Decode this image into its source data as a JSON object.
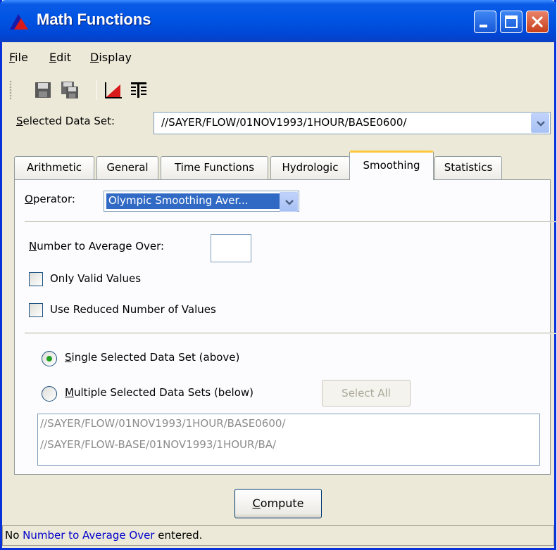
{
  "window": {
    "title": "Math Functions",
    "title_bar_color": "#0054E3"
  },
  "menu": {
    "items": [
      {
        "label": "File",
        "mnemonic": "F",
        "rest": "ile"
      },
      {
        "label": "Edit",
        "mnemonic": "E",
        "rest": "dit"
      },
      {
        "label": "Display",
        "mnemonic": "D",
        "rest": "isplay"
      }
    ]
  },
  "toolbar": {
    "icons": [
      "save-icon",
      "save-as-icon",
      "plot-icon",
      "tabulate-icon"
    ]
  },
  "selected_data_set": {
    "label_mnemonic": "S",
    "label_rest": "elected Data Set:",
    "value": "//SAYER/FLOW/01NOV1993/1HOUR/BASE0600/"
  },
  "tabs": [
    {
      "label": "Arithmetic",
      "active": false
    },
    {
      "label": "General",
      "active": false
    },
    {
      "label": "Time Functions",
      "active": false
    },
    {
      "label": "Hydrologic",
      "active": false
    },
    {
      "label": "Smoothing",
      "active": true
    },
    {
      "label": "Statistics",
      "active": false
    }
  ],
  "smoothing": {
    "operator_label_mnemonic": "O",
    "operator_label_rest": "perator:",
    "operator_value": "Olympic Smoothing Aver...",
    "number_label_mnemonic": "N",
    "number_label_rest": "umber to Average Over:",
    "number_value": "",
    "only_valid_label": "Only Valid Values",
    "only_valid_checked": false,
    "use_reduced_label": "Use Reduced Number of Values",
    "use_reduced_checked": false,
    "single_label_mnemonic": "S",
    "single_label_rest": "ingle Selected Data Set (above)",
    "single_selected": true,
    "multiple_label_mnemonic": "M",
    "multiple_label_rest": "ultiple Selected Data Sets (below)",
    "multiple_selected": false,
    "select_all_label": "Select All",
    "data_sets": [
      "//SAYER/FLOW/01NOV1993/1HOUR/BASE0600/",
      "//SAYER/FLOW-BASE/01NOV1993/1HOUR/BA/"
    ]
  },
  "compute": {
    "mnemonic": "C",
    "rest": "ompute"
  },
  "status": {
    "prefix": "No ",
    "highlight": "Number to Average Over",
    "suffix": " entered.",
    "highlight_color": "#0000CC"
  }
}
